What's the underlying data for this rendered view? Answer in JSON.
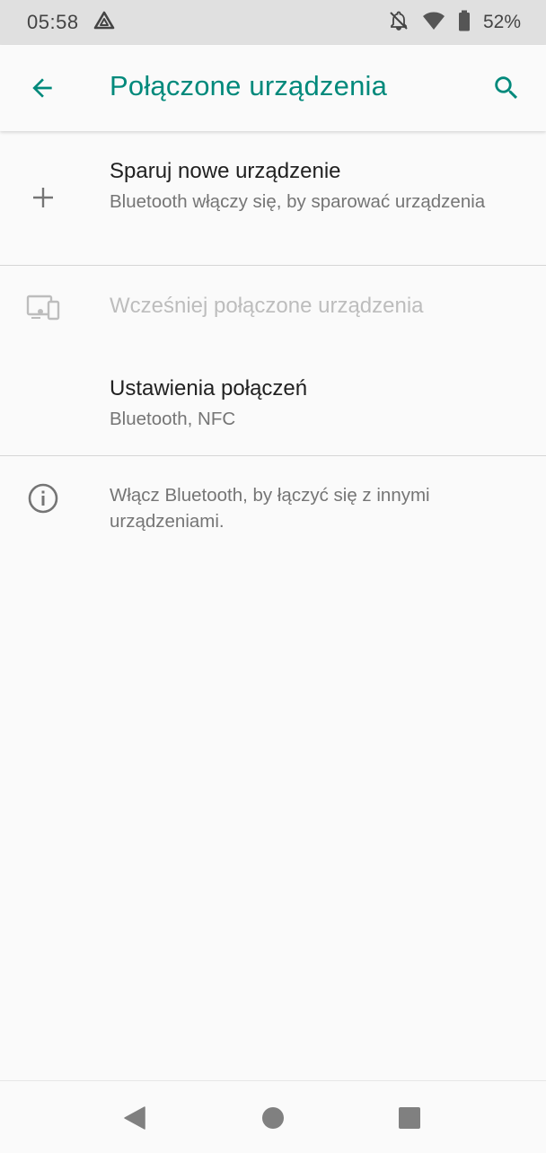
{
  "status_bar": {
    "time": "05:58",
    "battery": "52%",
    "icons": [
      "drive-icon",
      "notifications-off-icon",
      "wifi-icon",
      "battery-icon"
    ]
  },
  "app_bar": {
    "title": "Połączone urządzenia",
    "back_icon": "arrow-back-icon",
    "search_icon": "search-icon"
  },
  "items": [
    {
      "icon": "plus-icon",
      "title": "Sparuj nowe urządzenie",
      "summary": "Bluetooth włączy się, by sparować urządzenia"
    },
    {
      "icon": "devices-icon",
      "title": "Wcześniej połączone urządzenia",
      "enabled": false
    },
    {
      "title": "Ustawienia połączeń",
      "summary": "Bluetooth, NFC"
    }
  ],
  "footer": {
    "icon": "info-icon",
    "text": "Włącz Bluetooth, by łączyć się z innymi urządzeniami."
  },
  "nav_bar": {
    "buttons": [
      "back-triangle-icon",
      "home-circle-icon",
      "recents-square-icon"
    ]
  },
  "colors": {
    "accent": "#00897b",
    "background": "#fafafa",
    "status_bar": "#e0e0e0",
    "primary_text": "#212121",
    "secondary_text": "#757575",
    "disabled_text": "#bdbdbd"
  }
}
